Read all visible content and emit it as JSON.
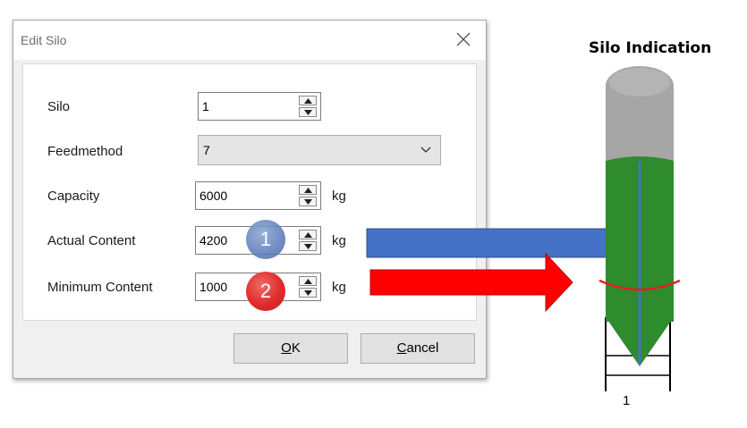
{
  "dialog": {
    "title": "Edit Silo",
    "fields": {
      "silo": {
        "label": "Silo",
        "value": "1"
      },
      "feedmethod": {
        "label": "Feedmethod",
        "value": "7"
      },
      "capacity": {
        "label": "Capacity",
        "value": "6000",
        "unit": "kg"
      },
      "actual_content": {
        "label": "Actual Content",
        "value": "4200",
        "unit": "kg"
      },
      "minimum_content": {
        "label": "Minimum Content",
        "value": "1000",
        "unit": "kg"
      }
    },
    "buttons": {
      "ok": {
        "mnemonic": "O",
        "rest": "K"
      },
      "cancel": {
        "mnemonic": "C",
        "rest": "ancel"
      }
    }
  },
  "markers": {
    "one": "1",
    "two": "2"
  },
  "silo_indication": {
    "title": "Silo Indication",
    "number": "1",
    "actual_content_fraction": 0.7,
    "minimum_content_fraction": 0.1667
  },
  "icons": {
    "close": "close-icon",
    "spin_up": "triangle-up-icon",
    "spin_down": "triangle-down-icon",
    "dropdown": "chevron-down-icon"
  },
  "colors": {
    "actual_arrow": "#4472c4",
    "minimum_arrow": "#ff0000",
    "silo_fill": "#2e8b2e",
    "silo_roof": "#a6a6a6",
    "content_line": "#4472c4",
    "minimum_ring": "#e02020"
  }
}
